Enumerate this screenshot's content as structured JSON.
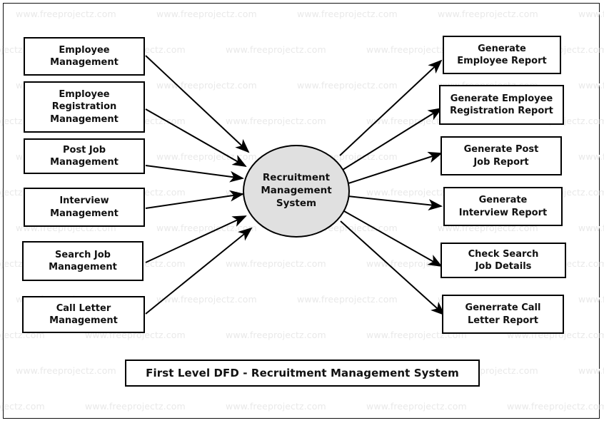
{
  "diagram": {
    "title": "First Level DFD - Recruitment Management System",
    "watermark_text": "www.freeprojectz.com",
    "process": {
      "name": "Recruitment Management System",
      "line1": "Recruitment",
      "line2": "Management",
      "line3": "System",
      "fill_color": "#e0e0e0",
      "border_color": "#000000"
    },
    "inputs": [
      {
        "id": "employee-management",
        "line1": "Employee",
        "line2": "Management",
        "line3": ""
      },
      {
        "id": "employee-registration-management",
        "line1": "Employee",
        "line2": "Registration",
        "line3": "Management"
      },
      {
        "id": "post-job-management",
        "line1": "Post Job",
        "line2": "Management",
        "line3": ""
      },
      {
        "id": "interview-management",
        "line1": "Interview",
        "line2": "Management",
        "line3": ""
      },
      {
        "id": "search-job-management",
        "line1": "Search Job",
        "line2": "Management",
        "line3": ""
      },
      {
        "id": "call-letter-management",
        "line1": "Call Letter",
        "line2": "Management",
        "line3": ""
      }
    ],
    "outputs": [
      {
        "id": "generate-employee-report",
        "line1": "Generate",
        "line2": "Employee Report",
        "line3": ""
      },
      {
        "id": "generate-employee-registration-report",
        "line1": "Generate Employee",
        "line2": "Registration Report",
        "line3": ""
      },
      {
        "id": "generate-post-job-report",
        "line1": "Generate Post",
        "line2": "Job Report",
        "line3": ""
      },
      {
        "id": "generate-interview-report",
        "line1": "Generate",
        "line2": "Interview Report",
        "line3": ""
      },
      {
        "id": "check-search-job-details",
        "line1": "Check Search",
        "line2": "Job Details",
        "line3": ""
      },
      {
        "id": "generate-call-letter-report",
        "line1": "Generrate Call",
        "line2": "Letter Report",
        "line3": ""
      }
    ]
  }
}
